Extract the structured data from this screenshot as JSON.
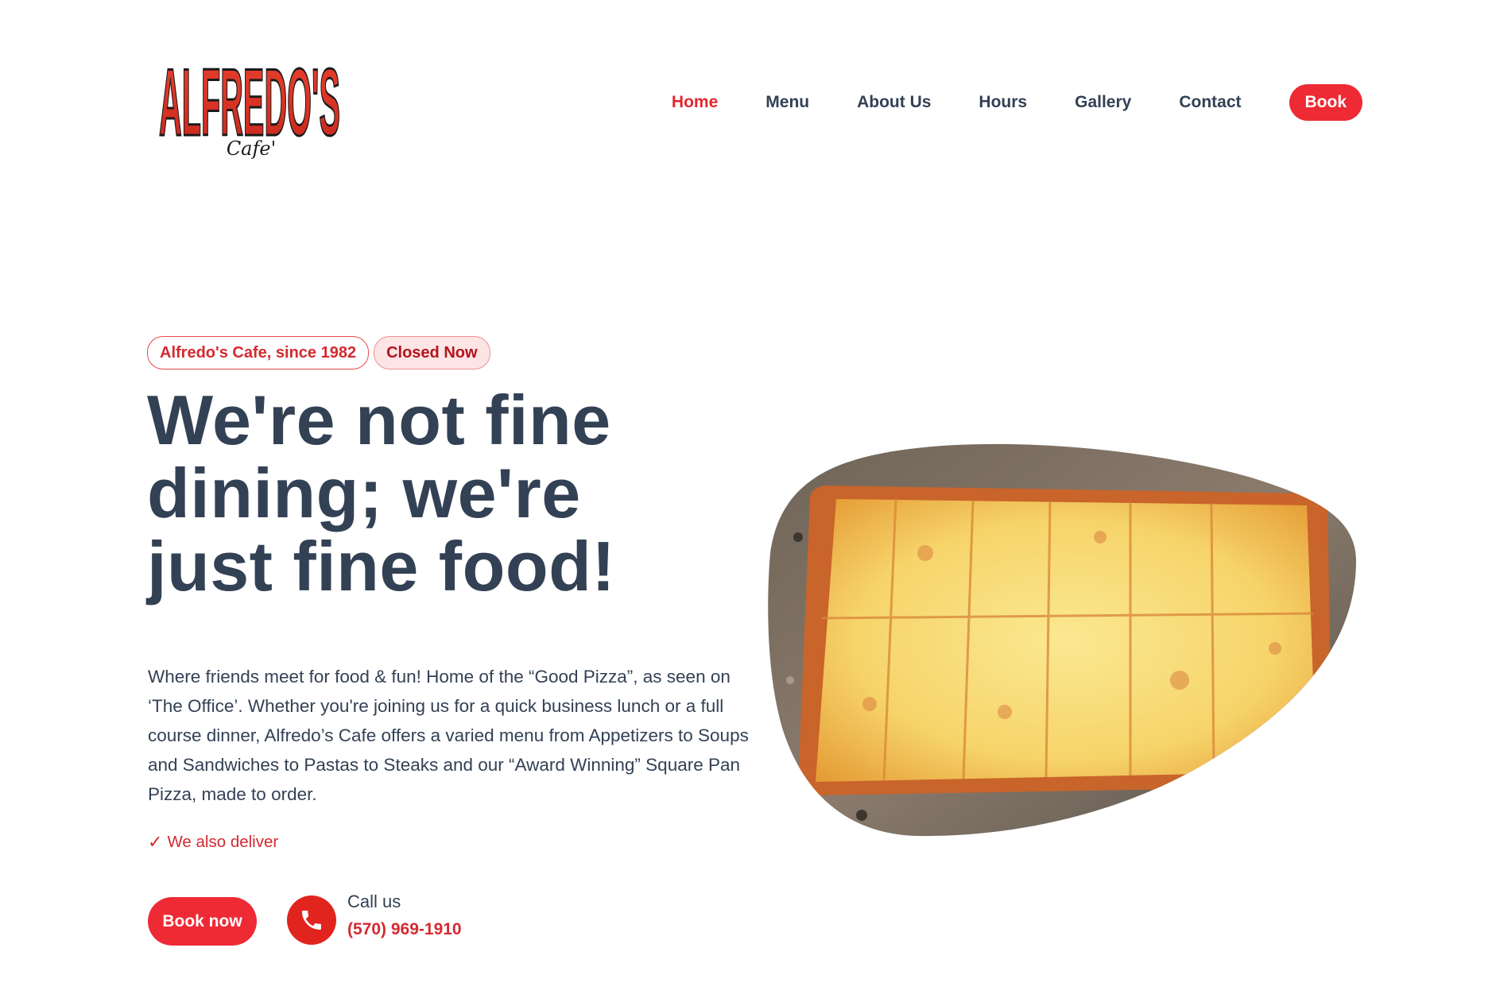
{
  "brand": {
    "logo_text": "ALFREDO'S",
    "logo_subtext": "Cafe'",
    "accent_color": "#ee2a35",
    "text_color": "#334155"
  },
  "nav": {
    "items": [
      {
        "label": "Home",
        "active": true
      },
      {
        "label": "Menu",
        "active": false
      },
      {
        "label": "About Us",
        "active": false
      },
      {
        "label": "Hours",
        "active": false
      },
      {
        "label": "Gallery",
        "active": false
      },
      {
        "label": "Contact",
        "active": false
      }
    ],
    "book_label": "Book"
  },
  "hero": {
    "badge_since": "Alfredo's Cafe, since 1982",
    "badge_status": "Closed Now",
    "headline": "We're not fine dining; we're just fine food!",
    "description": "Where friends meet for food & fun! Home of the “Good Pizza”, as seen on ‘The Office’. Whether you're joining us for a quick business lunch or a full course dinner, Alfredo’s Cafe offers a varied menu from Appetizers to Soups and Sandwiches to Pastas to Steaks and our “Award Winning” Square Pan Pizza, made to order.",
    "deliver_check": "✓",
    "deliver_text": "We also deliver",
    "book_now_label": "Book now",
    "call_label": "Call us",
    "phone": "(570) 969-1910",
    "image_icon": "square-pan-pizza-photo"
  }
}
